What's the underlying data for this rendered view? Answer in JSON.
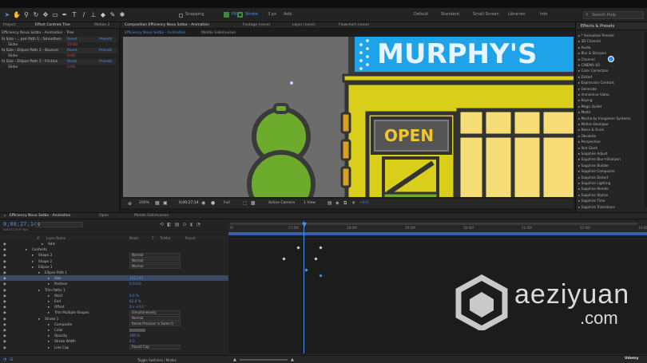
{
  "toolbar": {
    "tools": [
      "home-icon",
      "selection-icon",
      "hand-icon",
      "zoom-icon",
      "orbit-icon",
      "rectangle-icon",
      "pen-icon",
      "type-icon",
      "brush-icon",
      "clone-icon",
      "eraser-icon",
      "roto-icon",
      "puppet-icon"
    ],
    "snapping_label": "Snapping",
    "fill_label": "Fill",
    "stroke_label": "Stroke",
    "stroke_px": "3 px",
    "add_label": "Add:",
    "workspaces": [
      "Default",
      "Standard",
      "Small Screen",
      "Libraries",
      "Info"
    ],
    "search_placeholder": "Search Help"
  },
  "effects_panel": {
    "tabs": [
      "Project",
      "Effect Controls Tree",
      "Motion 2"
    ],
    "rows": [
      {
        "name": "Efficiency Nova Sotba - Animation - Tree",
        "val": "",
        "kind": "title"
      },
      {
        "name": "fx  Size - .. pse Path 1 - Smoothen",
        "val": "Reset",
        "val2": "Presets"
      },
      {
        "name": "  Slider",
        "val": "19.00"
      },
      {
        "name": "fx  Size - Ellipse Path 1 - Bounce",
        "val": "Reset",
        "val2": "Presets"
      },
      {
        "name": "  Slider",
        "val": "0.00"
      },
      {
        "name": "fx  Size - Ellipse Path 1 - Friction",
        "val": "Reset",
        "val2": "Presets"
      },
      {
        "name": "  Slider",
        "val": "0.00"
      }
    ]
  },
  "comp_panel": {
    "tabs": [
      "Composition Efficiency Nova Sotba - Animation",
      "Footage (none)",
      "Layer (none)",
      "Flowchart (none)"
    ],
    "subtabs": [
      "Efficiency Nova Sotba - Animation",
      "Middle Sailnhussen"
    ],
    "sign_text": "MURPHY'S",
    "open_text": "OPEN",
    "viewer_controls": {
      "zoom": "200%",
      "timecode": "0;00;27;14",
      "resolution": "Full",
      "camera": "Active Camera",
      "views": "1 View",
      "exposure": "+0.0"
    }
  },
  "presets_panel": {
    "title": "Effects & Presets",
    "items": [
      "* Animation Presets",
      "3D Channel",
      "Audio",
      "Blur & Sharpen",
      "Channel",
      "CINEMA 4D",
      "Color Correction",
      "Distort",
      "Expression Controls",
      "Generate",
      "Immersive Video",
      "Keying",
      "Magic Bullet",
      "Matte",
      "Mocha by Imagineer Systems",
      "Motion Boutique",
      "Noise & Grain",
      "Obsolete",
      "Perspective",
      "Red Giant",
      "Sapphire Adjust",
      "Sapphire Blur+Sharpen",
      "Sapphire Builder",
      "Sapphire Composite",
      "Sapphire Distort",
      "Sapphire Lighting",
      "Sapphire Render",
      "Sapphire Stylize",
      "Sapphire Time",
      "Sapphire Transitions"
    ]
  },
  "timeline": {
    "tabs": [
      "Efficiency Nova Sotba - Animation",
      "Open",
      "Middle Sailnhussen"
    ],
    "timecode": "0;00;27;14",
    "fps": "00824 (29.97 fps)",
    "col_headers": [
      "#",
      "Layer Name",
      "Mode",
      "T",
      "TrkMat",
      "Parent"
    ],
    "ruler": [
      "0f",
      "27:00f",
      "28:00f",
      "29:00f",
      "30:00f",
      "31:00f",
      "32:00f",
      "33:00f"
    ],
    "layers": [
      {
        "name": "Add:",
        "mode": "",
        "indent": 60
      },
      {
        "name": "Contents",
        "mode": "",
        "indent": 40
      },
      {
        "name": "Shape 3",
        "mode": "Normal",
        "indent": 48
      },
      {
        "name": "Shape 2",
        "mode": "Normal",
        "indent": 48
      },
      {
        "name": "Ellipse 1",
        "mode": "Normal",
        "indent": 48
      },
      {
        "name": "Ellipse Path 1",
        "mode": "",
        "indent": 56
      },
      {
        "name": "Size",
        "mode": "",
        "indent": 68,
        "val": "142,142",
        "sel": true
      },
      {
        "name": "Position",
        "mode": "",
        "indent": 68,
        "val": "0.0,0.0"
      },
      {
        "name": "Trim Paths 1",
        "mode": "",
        "indent": 56
      },
      {
        "name": "Start",
        "mode": "",
        "indent": 68,
        "val": "0.0 %"
      },
      {
        "name": "End",
        "mode": "",
        "indent": 68,
        "val": "82.0 %"
      },
      {
        "name": "Offset",
        "mode": "",
        "indent": 68,
        "val": "0 x +0.0 °"
      },
      {
        "name": "Trim Multiple Shapes",
        "mode": "Simultaneously",
        "indent": 68
      },
      {
        "name": "Stroke 1",
        "mode": "Normal",
        "indent": 56
      },
      {
        "name": "Composite",
        "mode": "Below Previous in Same G",
        "indent": 68
      },
      {
        "name": "Color",
        "mode": "",
        "indent": 68,
        "val": ""
      },
      {
        "name": "Opacity",
        "mode": "",
        "indent": 68,
        "val": "100 %"
      },
      {
        "name": "Stroke Width",
        "mode": "",
        "indent": 68,
        "val": "4.0"
      },
      {
        "name": "Line Cap",
        "mode": "Round Cap",
        "indent": 68
      }
    ],
    "footer_label": "Toggle Switches / Modes"
  },
  "watermark": {
    "brand": "aeziyuan",
    "domain": ".com"
  },
  "udemy": "Udemy",
  "colors": {
    "accent_blue": "#2d8ceb",
    "sign_blue": "#1ea2e8",
    "building_yellow": "#d9cf1a",
    "tree_green": "#6cab2c",
    "window_yellow": "#f6dc74",
    "playhead": "#4a8fe8"
  }
}
